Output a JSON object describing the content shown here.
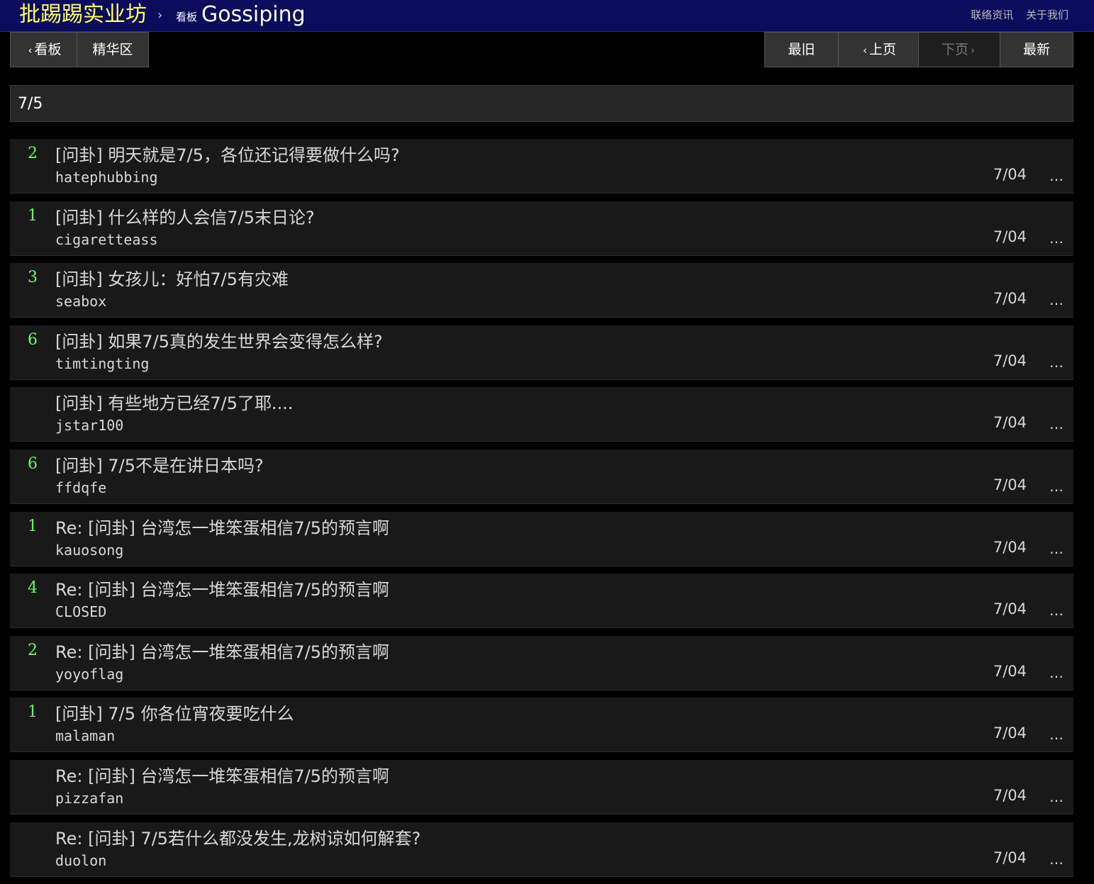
{
  "header": {
    "site_title": "批踢踢实业坊",
    "breadcrumb_sep": "›",
    "board_label": "看板",
    "board_name": "Gossiping",
    "links": [
      "联络资讯",
      "关于我们"
    ]
  },
  "nav": {
    "back_label": "看板",
    "digest_label": "精华区",
    "oldest_label": "最旧",
    "prev_label": "上页",
    "next_label": "下页",
    "newest_label": "最新"
  },
  "search": {
    "query": "7/5"
  },
  "posts": [
    {
      "push": "2",
      "title": "[问卦] 明天就是7/5，各位还记得要做什么吗?",
      "author": "hatephubbing",
      "date": "7/04",
      "more": "…"
    },
    {
      "push": "1",
      "title": "[问卦] 什么样的人会信7/5末日论?",
      "author": "cigaretteass",
      "date": "7/04",
      "more": "…"
    },
    {
      "push": "3",
      "title": "[问卦] 女孩儿：好怕7/5有灾难",
      "author": "seabox",
      "date": "7/04",
      "more": "…"
    },
    {
      "push": "6",
      "title": "[问卦] 如果7/5真的发生世界会变得怎么样?",
      "author": "timtingting",
      "date": "7/04",
      "more": "…"
    },
    {
      "push": "",
      "title": "[问卦] 有些地方已经7/5了耶....",
      "author": "jstar100",
      "date": "7/04",
      "more": "…"
    },
    {
      "push": "6",
      "title": "[问卦] 7/5不是在讲日本吗?",
      "author": "ffdqfe",
      "date": "7/04",
      "more": "…"
    },
    {
      "push": "1",
      "title": "Re: [问卦] 台湾怎一堆笨蛋相信7/5的预言啊",
      "author": "kauosong",
      "date": "7/04",
      "more": "…"
    },
    {
      "push": "4",
      "title": "Re: [问卦] 台湾怎一堆笨蛋相信7/5的预言啊",
      "author": "CLOSED",
      "date": "7/04",
      "more": "…"
    },
    {
      "push": "2",
      "title": "Re: [问卦] 台湾怎一堆笨蛋相信7/5的预言啊",
      "author": "yoyoflag",
      "date": "7/04",
      "more": "…"
    },
    {
      "push": "1",
      "title": "[问卦] 7/5 你各位宵夜要吃什么",
      "author": "malaman",
      "date": "7/04",
      "more": "…"
    },
    {
      "push": "",
      "title": "Re: [问卦] 台湾怎一堆笨蛋相信7/5的预言啊",
      "author": "pizzafan",
      "date": "7/04",
      "more": "…"
    },
    {
      "push": "",
      "title": "Re: [问卦] 7/5若什么都没发生,龙树谅如何解套?",
      "author": "duolon",
      "date": "7/04",
      "more": "…"
    }
  ],
  "colors": {
    "header_bg": "#0c0c5c",
    "site_title": "#ffff66",
    "push_count": "#66ff66",
    "row_bg": "#191919"
  },
  "icons": {
    "chevron_left": "chevron-left-icon",
    "chevron_right": "chevron-right-icon",
    "more": "more-icon"
  }
}
